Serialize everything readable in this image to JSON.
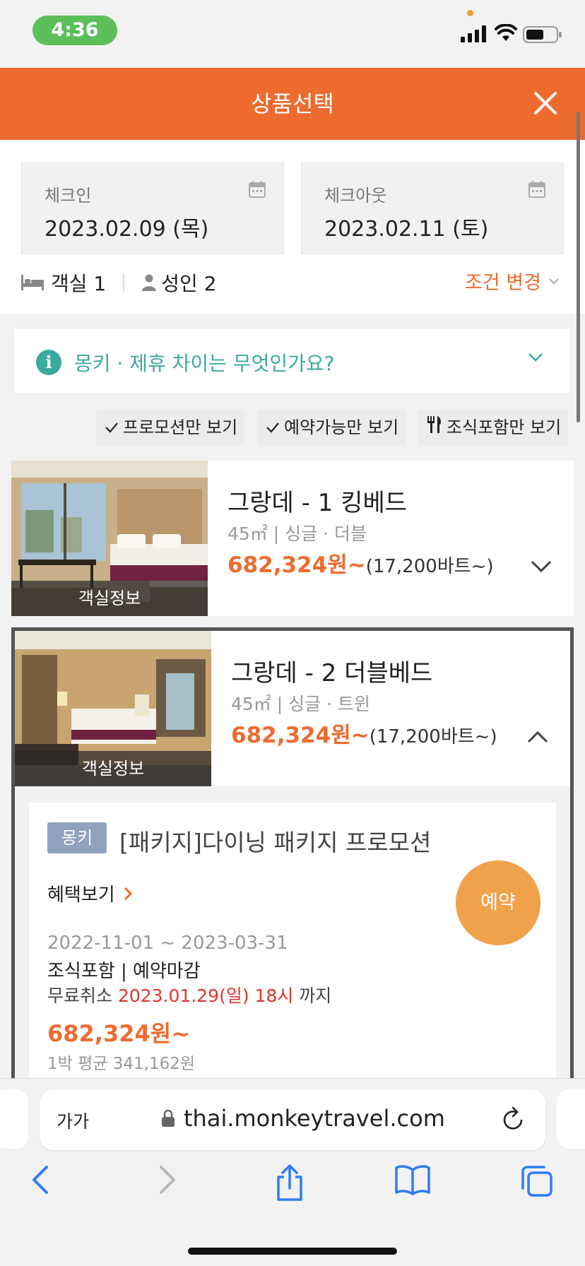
{
  "status_bar": {
    "time": "4:36"
  },
  "header": {
    "title": "상품선택"
  },
  "conditions": {
    "checkin": {
      "label": "체크인",
      "date": "2023.02.09 (목)"
    },
    "checkout": {
      "label": "체크아웃",
      "date": "2023.02.11 (토)"
    },
    "rooms": "객실 1",
    "adults": "성인 2",
    "change_label": "조건 변경"
  },
  "info_bar": {
    "text": "몽키 · 제휴 차이는 무엇인가요?"
  },
  "filters": [
    {
      "label": "프로모션만 보기",
      "icon": "check-icon"
    },
    {
      "label": "예약가능만 보기",
      "icon": "check-icon"
    },
    {
      "label": "조식포함만 보기",
      "icon": "fork-knife-icon"
    }
  ],
  "rooms": [
    {
      "name": "그랑데 - 1 킹베드",
      "spec": "45㎡ | 싱글 · 더블",
      "price": "682,324원~",
      "price_sub": "(17,200바트~)",
      "info_label": "객실정보",
      "expanded": false
    },
    {
      "name": "그랑데 - 2 더블베드",
      "spec": "45㎡ | 싱글 · 트윈",
      "price": "682,324원~",
      "price_sub": "(17,200바트~)",
      "info_label": "객실정보",
      "expanded": true
    }
  ],
  "package": {
    "badge": "몽키",
    "title": "[패키지]다이닝 패키지 프로모션",
    "benefit_label": "혜택보기",
    "reserve_label": "예약",
    "period": "2022-11-01 ~ 2023-03-31",
    "meal": "조식포함 | 예약마감",
    "cancel_prefix": "무료취소 ",
    "cancel_date": "2023.01.29(일) 18시",
    "cancel_suffix": " 까지",
    "price": "682,324원~",
    "avg": "1박 평균 341,162원"
  },
  "browser": {
    "aa_label": "가가",
    "url": "thai.monkeytravel.com"
  },
  "colors": {
    "brand": "#ee6b2f",
    "teal": "#3aaa9e",
    "reserve": "#f0a24a",
    "red": "#e0342b"
  }
}
